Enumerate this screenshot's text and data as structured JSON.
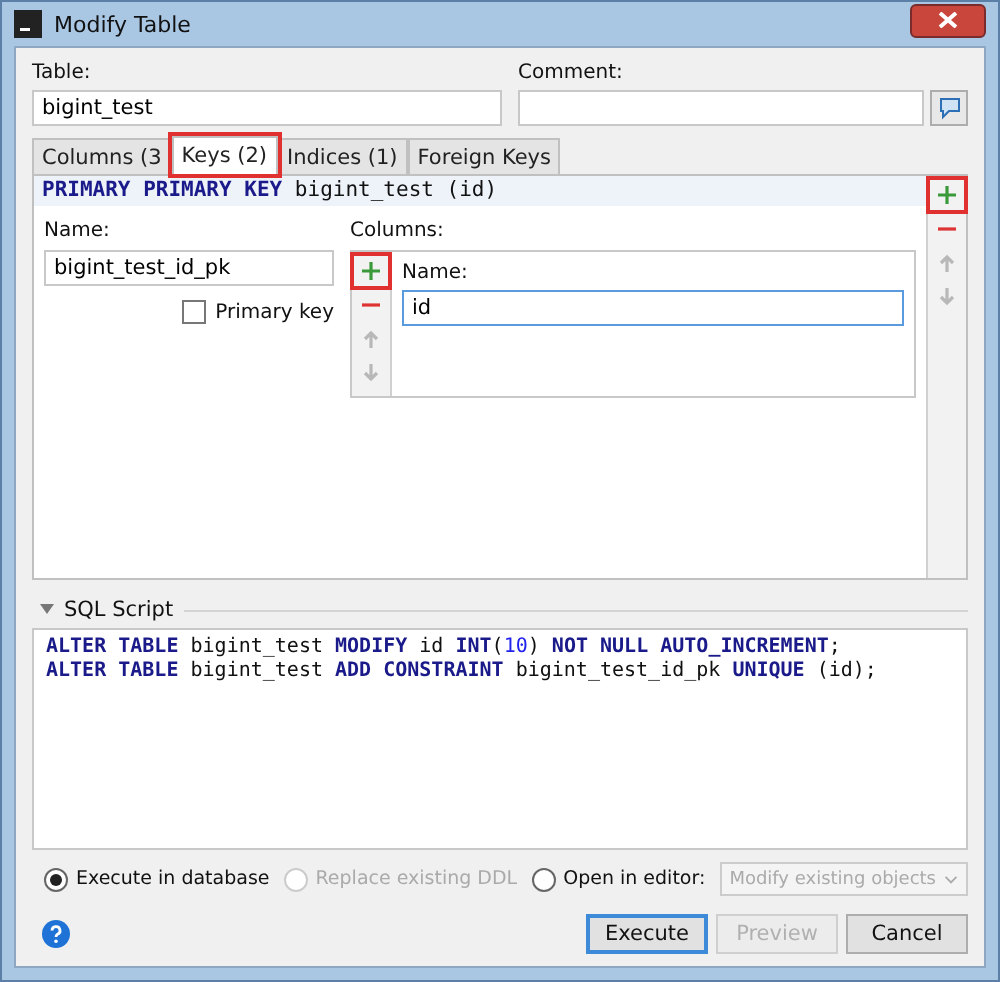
{
  "window": {
    "title": "Modify Table"
  },
  "table_field": {
    "label": "Table:",
    "value": "bigint_test"
  },
  "comment_field": {
    "label": "Comment:"
  },
  "tabs": [
    {
      "label": "Columns (3",
      "selected": false,
      "highlighted": false
    },
    {
      "label": "Keys (2)",
      "selected": true,
      "highlighted": true
    },
    {
      "label": "Indices (1)",
      "selected": false,
      "highlighted": false
    },
    {
      "label": "Foreign Keys",
      "selected": false,
      "highlighted": false
    }
  ],
  "key_header": [
    {
      "kind": "keyword",
      "text": "PRIMARY PRIMARY KEY"
    },
    {
      "kind": "plain",
      "text": " bigint_test (id)"
    }
  ],
  "key_toolbar": [
    {
      "kind": "add",
      "highlighted": true,
      "disabled": false
    },
    {
      "kind": "remove",
      "highlighted": false,
      "disabled": false
    },
    {
      "kind": "up",
      "highlighted": false,
      "disabled": true
    },
    {
      "kind": "down",
      "highlighted": false,
      "disabled": true
    }
  ],
  "name_field": {
    "label": "Name:",
    "value": "bigint_test_id_pk"
  },
  "primary_key": {
    "label": "Primary key",
    "checked": false
  },
  "columns": {
    "label": "Columns:",
    "toolbar": [
      {
        "kind": "add",
        "highlighted": true,
        "disabled": false
      },
      {
        "kind": "remove",
        "highlighted": false,
        "disabled": false
      },
      {
        "kind": "up",
        "highlighted": false,
        "disabled": true
      },
      {
        "kind": "down",
        "highlighted": false,
        "disabled": true
      }
    ],
    "column_label": "Name:",
    "value": "id"
  },
  "sql_script": {
    "title": "SQL Script",
    "expanded": true,
    "lines": [
      [
        {
          "kind": "keyword",
          "text": "ALTER TABLE"
        },
        {
          "kind": "plain",
          "text": " bigint_test "
        },
        {
          "kind": "keyword",
          "text": "MODIFY"
        },
        {
          "kind": "plain",
          "text": " id "
        },
        {
          "kind": "keyword",
          "text": "INT"
        },
        {
          "kind": "plain",
          "text": "("
        },
        {
          "kind": "number",
          "text": "10"
        },
        {
          "kind": "plain",
          "text": ") "
        },
        {
          "kind": "keyword",
          "text": "NOT NULL AUTO_INCREMENT"
        },
        {
          "kind": "plain",
          "text": ";"
        }
      ],
      [
        {
          "kind": "keyword",
          "text": "ALTER TABLE"
        },
        {
          "kind": "plain",
          "text": " bigint_test "
        },
        {
          "kind": "keyword",
          "text": "ADD CONSTRAINT"
        },
        {
          "kind": "plain",
          "text": " bigint_test_id_pk "
        },
        {
          "kind": "keyword",
          "text": "UNIQUE"
        },
        {
          "kind": "plain",
          "text": " (id);"
        }
      ]
    ]
  },
  "options": [
    {
      "label": "Execute in database",
      "selected": true,
      "disabled": false
    },
    {
      "label": "Replace existing DDL",
      "selected": false,
      "disabled": true
    },
    {
      "label": "Open in editor:",
      "selected": false,
      "disabled": false
    }
  ],
  "editor_mode": {
    "value": "Modify existing objects",
    "disabled": true
  },
  "buttons": [
    {
      "label": "Execute",
      "default": true,
      "disabled": false
    },
    {
      "label": "Preview",
      "default": false,
      "disabled": true
    },
    {
      "label": "Cancel",
      "default": false,
      "disabled": false
    }
  ]
}
